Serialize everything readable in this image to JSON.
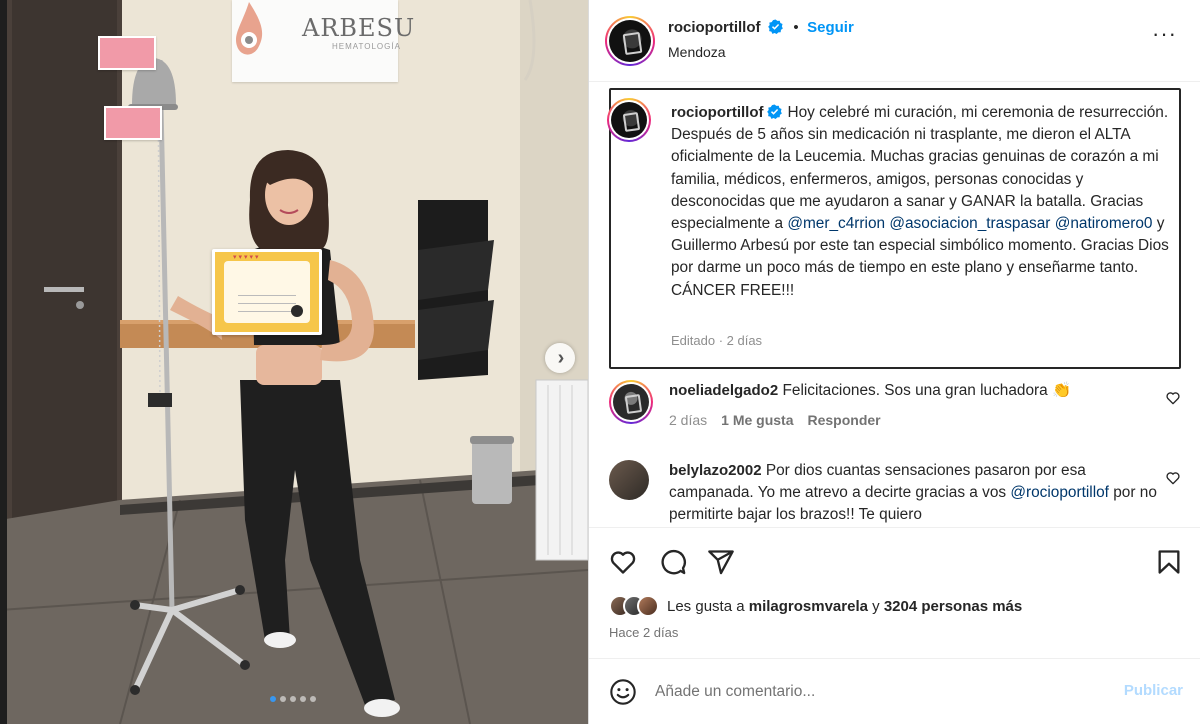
{
  "post": {
    "username": "rocioportillof",
    "follow_label": "Seguir",
    "separator": "•",
    "location": "Mendoza",
    "more_icon": "more-horizontal-icon"
  },
  "photo": {
    "sign_brand": "ARBESU",
    "sign_sub": "HEMATOLOGÍA",
    "carousel_dot_count": 5,
    "carousel_active_index": 0
  },
  "caption": {
    "username": "rocioportillof",
    "text_1": "Hoy celebré mi curación, mi ceremonia de resurrección. Después de 5 años sin medicación ni trasplante, me dieron el ALTA oficialmente de la Leucemia. Muchas gracias genuinas de corazón a mi familia, médicos, enfermeros, amigos, personas conocidas y desconocidas que me ayudaron a sanar y GANAR la batalla. Gracias especialmente a ",
    "mention_1": "@mer_c4rrion",
    "mention_2": "@asociacion_traspasar",
    "mention_3": "@natiromero0",
    "text_2": " y Guillermo Arbesú por este tan especial simbólico momento. Gracias Dios por darme un poco más de tiempo en este plano y enseñarme tanto. CÁNCER FREE!!!",
    "meta": "Editado · 2 días"
  },
  "comments": [
    {
      "username": "noeliadelgado2",
      "text": "Felicitaciones. Sos una gran luchadora 👏",
      "time": "2 días",
      "likes": "1 Me gusta",
      "reply": "Responder"
    },
    {
      "username": "belylazo2002",
      "text_1": "Por dios cuantas sensaciones pasaron por esa campanada. Yo me atrevo a decirte gracias a vos ",
      "mention": "@rocioportillof",
      "text_2": " por no permitirte bajar los brazos!! Te quiero"
    }
  ],
  "likes": {
    "prefix": "Les gusta a ",
    "user": "milagrosmvarela",
    "middle": " y ",
    "count": "3204 personas más"
  },
  "date": "Hace 2 días",
  "add_comment": {
    "placeholder": "Añade un comentario...",
    "publish": "Publicar"
  },
  "colors": {
    "link": "#0095f6",
    "mention": "#00376b",
    "publish_disabled": "#b3dbff"
  }
}
